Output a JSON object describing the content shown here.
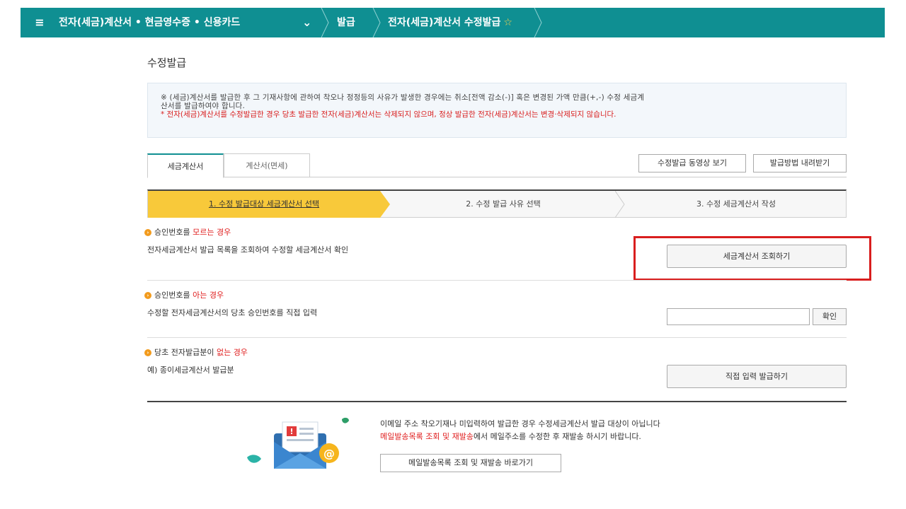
{
  "topbar": {
    "menu_icon": "≡",
    "category": "전자(세금)계산서 • 현금영수증 • 신용카드",
    "dropdown_icon": "⌄",
    "crumb_issue": "발급",
    "crumb_page": "전자(세금)계산서 수정발급",
    "favorite_icon": "☆",
    "bg_color": "#0f8f92"
  },
  "page_title": "수정발급",
  "notice": {
    "line1": "※ (세금)계산서를 발급한 후 그 기재사항에 관하여 착오나 정정등의 사유가 발생한 경우에는 취소[전액 감소(-)] 혹은 변경된 가액 만큼(+,-) 수정 세금계",
    "line2": "산서를 발급하여야 합니다.",
    "line3": "* 전자(세금)계산서를 수정발급한 경우 당초 발급한 전자(세금)계산서는 삭제되지 않으며, 정상 발급한 전자(세금)계산서는 변경·삭제되지 않습니다."
  },
  "tabs": [
    {
      "label": "세금계산서",
      "active": true
    },
    {
      "label": "계산서(면세)",
      "active": false
    }
  ],
  "actions": {
    "video_label": "수정발급 동영상 보기",
    "download_label": "발급방법 내려받기"
  },
  "steps": [
    {
      "label": "1. 수정 발급대상 세금계산서 선택",
      "active": true
    },
    {
      "label": "2. 수정 발급 사유 선택",
      "active": false
    },
    {
      "label": "3. 수정 세금계산서 작성",
      "active": false
    }
  ],
  "sections": {
    "unknown": {
      "title_prefix": "승인번호를 ",
      "title_highlight": "모르는 경우",
      "desc": "전자세금계산서 발급 목록을 조회하여 수정할 세금계산서 확인",
      "button_label": "세금계산서 조회하기"
    },
    "known": {
      "title_prefix": "승인번호를 ",
      "title_highlight": "아는 경우",
      "desc": "수정할 전자세금계산서의 당초 승인번호를 직접 입력",
      "input_value": "",
      "confirm_label": "확인"
    },
    "none": {
      "title_prefix": "당초 전자발급분이 ",
      "title_highlight": "없는 경우",
      "desc": "예) 종이세금계산서 발급분",
      "button_label": "직접 입력 발급하기"
    }
  },
  "mail_info": {
    "line1": "이메일 주소 착오기재나 미입력하여 발급한 경우 수정세금계산서 발급 대상이 아닙니다",
    "line2_highlight": "메일발송목록 조회 및 재발송",
    "line2_rest": "에서 메일주소를 수정한 후 재발송 하시기 바랍니다.",
    "button_label": "메일발송목록 조회 및 재발송 바로가기"
  },
  "colors": {
    "accent": "#0f8f92",
    "step_active": "#f8c93a",
    "highlight_box": "#d91e1e",
    "emphasis": "#e02020"
  }
}
